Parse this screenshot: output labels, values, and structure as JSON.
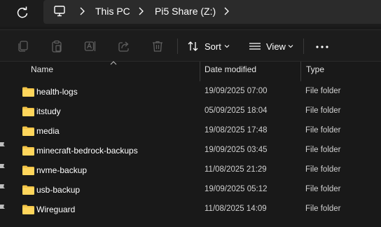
{
  "address_bar": {
    "breadcrumbs": [
      "This PC",
      "Pi5 Share (Z:)"
    ]
  },
  "toolbar": {
    "icons": [
      "copy-icon",
      "paste-icon",
      "rename-icon",
      "share-icon",
      "delete-icon"
    ],
    "sort_label": "Sort",
    "view_label": "View"
  },
  "columns": {
    "name": "Name",
    "date_modified": "Date modified",
    "type": "Type"
  },
  "files": [
    {
      "name": "health-logs",
      "date": "19/09/2025 07:00",
      "type": "File folder"
    },
    {
      "name": "itstudy",
      "date": "05/09/2025 18:04",
      "type": "File folder"
    },
    {
      "name": "media",
      "date": "19/08/2025 17:48",
      "type": "File folder"
    },
    {
      "name": "minecraft-bedrock-backups",
      "date": "19/09/2025 03:45",
      "type": "File folder"
    },
    {
      "name": "nvme-backup",
      "date": "11/08/2025 21:29",
      "type": "File folder"
    },
    {
      "name": "usb-backup",
      "date": "19/09/2025 05:12",
      "type": "File folder"
    },
    {
      "name": "Wireguard",
      "date": "11/08/2025 14:09",
      "type": "File folder"
    }
  ],
  "colors": {
    "background": "#191919",
    "folder": "#f3c448",
    "icon_dim": "#6b6b6b"
  }
}
